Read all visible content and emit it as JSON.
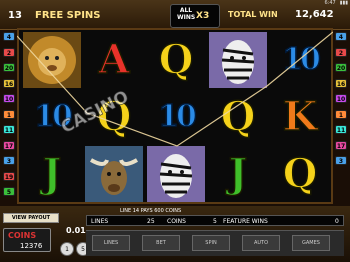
{
  "status_bar": {
    "time": "6:47",
    "battery": "▮▮▮"
  },
  "top_bar": {
    "free_spins_count": "13",
    "free_spins_label": "FREE SPINS",
    "multiplier_label": "ALL WINS",
    "multiplier_value": "X3",
    "total_win_label": "TOTAL WIN",
    "total_win_value": "12,642"
  },
  "paylines_left": [
    "4",
    "2",
    "20",
    "16",
    "10",
    "1",
    "11",
    "17",
    "3",
    "19",
    "5"
  ],
  "paylines_right": [
    "14",
    "12",
    "9",
    "18",
    "6",
    "8",
    "15",
    "7",
    "13"
  ],
  "reels": [
    [
      "lion",
      "10",
      "J"
    ],
    [
      "A",
      "Q",
      "bull"
    ],
    [
      "Q",
      "10",
      "zebra"
    ],
    [
      "zebra",
      "Q",
      "J"
    ],
    [
      "10",
      "K",
      "Q"
    ]
  ],
  "symbol_colors": {
    "A": "#e8322a",
    "K": "#f07a1a",
    "Q": "#f5d21a",
    "J": "#3fbf2a",
    "10": "#2b8be6"
  },
  "watermark": "CASINO",
  "bottom": {
    "view_payout": "VIEW PAYOUT",
    "coins_label": "COINS",
    "coins_value": "12376",
    "coin_size": "0.01",
    "payout_message": "LINE 14 PAYS 600 COINS",
    "lines_label": "LINES",
    "lines_value": "25",
    "coins_bet_label": "COINS",
    "coins_bet_value": "5",
    "feature_wins_label": "FEATURE WINS",
    "feature_wins_value": "0",
    "chips": [
      "1",
      "5"
    ],
    "buttons": [
      "LINES",
      "BET",
      "SPIN",
      "AUTO",
      "GAMES"
    ]
  }
}
